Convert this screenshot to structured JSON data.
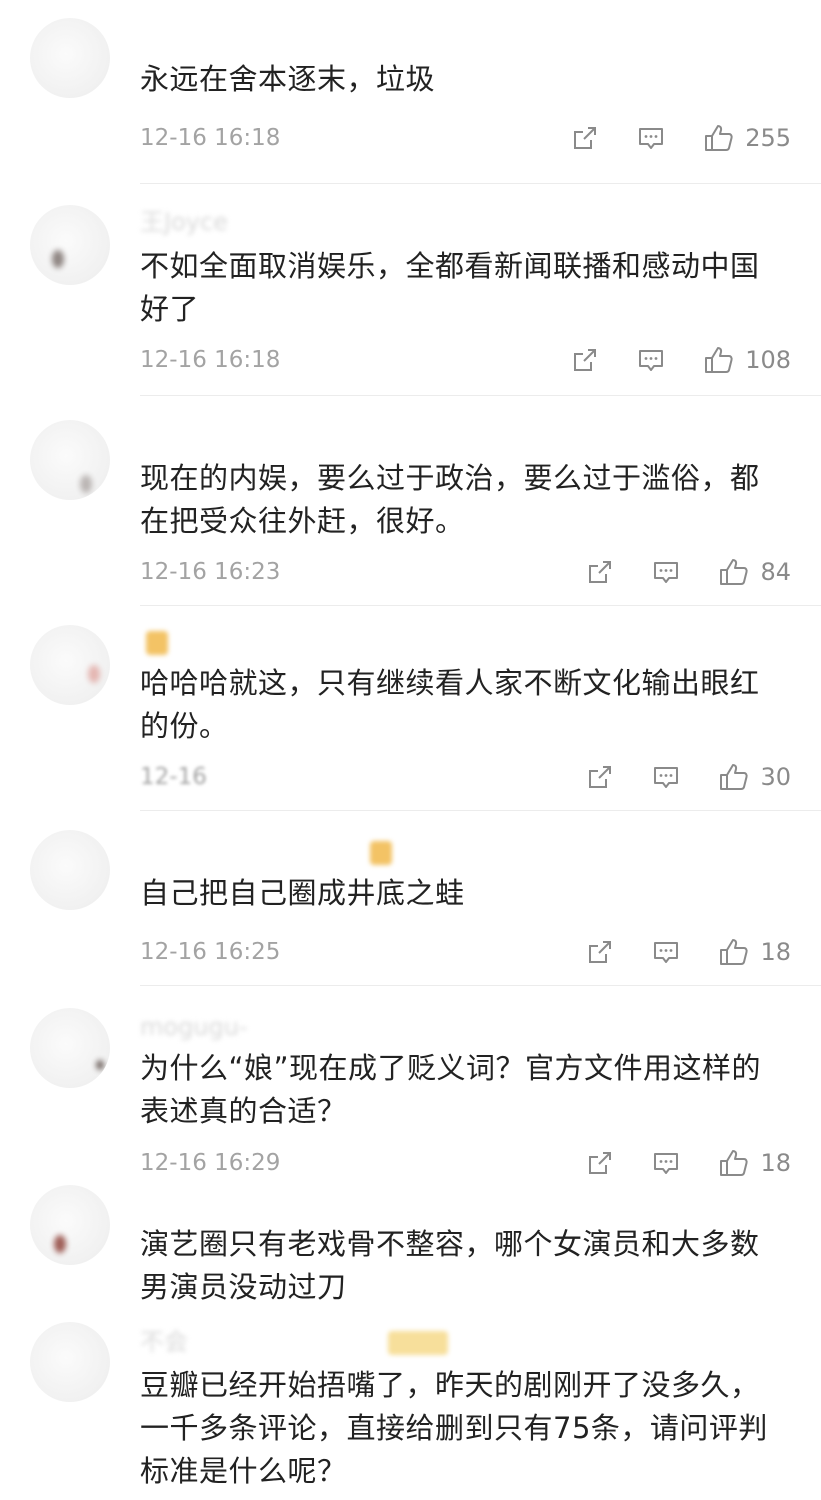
{
  "comments": [
    {
      "username": "",
      "text_lines": [
        "永远在舍本逐末，垃圾"
      ],
      "time": "12-16 16:18",
      "likes": "255"
    },
    {
      "username": "王Joyce",
      "text_lines": [
        "不如全面取消娱乐，全都看新闻联播和感动中国",
        "好了"
      ],
      "time": "12-16 16:18",
      "likes": "108"
    },
    {
      "username": "",
      "text_lines": [
        "现在的内娱，要么过于政治，要么过于滥俗，都",
        "在把受众往外赶，很好。"
      ],
      "time": "12-16 16:23",
      "likes": "84"
    },
    {
      "username": "",
      "text_lines": [
        "哈哈哈就这，只有继续看人家不断文化输出眼红",
        "的份。"
      ],
      "time": "12-16",
      "likes": "30"
    },
    {
      "username": "",
      "text_lines": [
        "自己把自己圈成井底之蛙"
      ],
      "time": "12-16 16:25",
      "likes": "18"
    },
    {
      "username": "mogugu-",
      "text_lines": [
        "为什么“娘”现在成了贬义词？官方文件用这样的",
        "表述真的合适？"
      ],
      "time": "12-16 16:29",
      "likes": "18"
    },
    {
      "username": "",
      "text_lines": [
        "演艺圈只有老戏骨不整容，哪个女演员和大多数",
        "男演员没动过刀"
      ],
      "time": "",
      "likes": ""
    },
    {
      "username": "不会",
      "text_lines": [
        "豆瓣已经开始捂嘴了，昨天的剧刚开了没多久，",
        "一千多条评论，直接给删到只有75条，请问评判",
        "标准是什么呢？"
      ],
      "time": "",
      "likes": ""
    }
  ],
  "icons": {
    "share": "share-icon",
    "reply": "comment-icon",
    "like": "thumbs-up-icon"
  },
  "colors": {
    "text": "#222222",
    "meta": "#a3a3a3",
    "icon": "#8a8a8a",
    "divider": "#ececec"
  }
}
